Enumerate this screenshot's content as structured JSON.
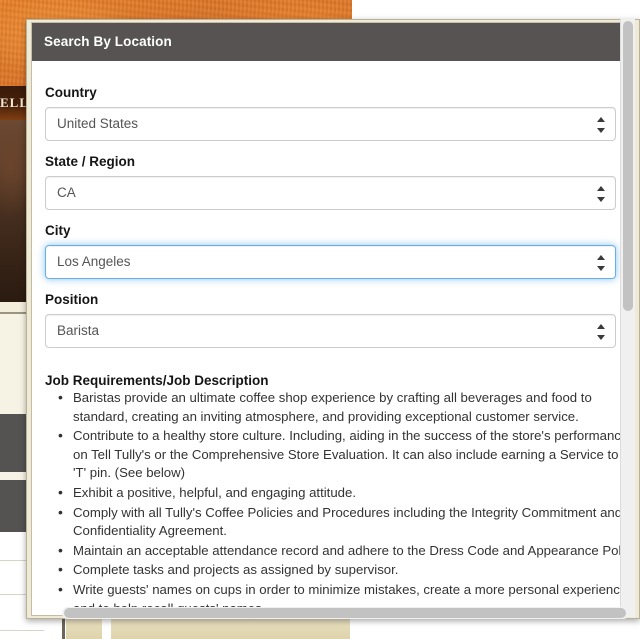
{
  "background": {
    "banner_text": "ELL T"
  },
  "modal": {
    "title": "Search By Location",
    "fields": [
      {
        "label": "Country",
        "value": "United States",
        "focused": false
      },
      {
        "label": "State / Region",
        "value": "CA",
        "focused": false
      },
      {
        "label": "City",
        "value": "Los Angeles",
        "focused": true
      },
      {
        "label": "Position",
        "value": "Barista",
        "focused": false
      }
    ],
    "job": {
      "heading": "Job Requirements/Job Description",
      "bullets": [
        "Baristas provide an ultimate coffee shop experience by crafting all beverages and food to standard, creating an inviting atmosphere, and providing exceptional customer service.",
        "Contribute to a healthy store culture. Including, aiding in the success of the store's performance on Tell Tully's or the Comprehensive Store Evaluation. It can also include earning a Service to a 'T' pin. (See below)",
        "Exhibit a positive, helpful, and engaging attitude.",
        "Comply with all Tully's Coffee Policies and Procedures including the Integrity Commitment and Confidentiality Agreement.",
        "Maintain an acceptable attendance record and adhere to the Dress Code and Appearance Policy.",
        "Complete tasks and projects as assigned by supervisor.",
        "Write guests' names on cups in order to minimize mistakes, create a more personal experience, and to help recall guests' names."
      ]
    }
  },
  "colors": {
    "header_bar": "#565352",
    "focus_ring": "#66afe9",
    "accent_orange": "#d9742a",
    "body_text": "#333333"
  }
}
